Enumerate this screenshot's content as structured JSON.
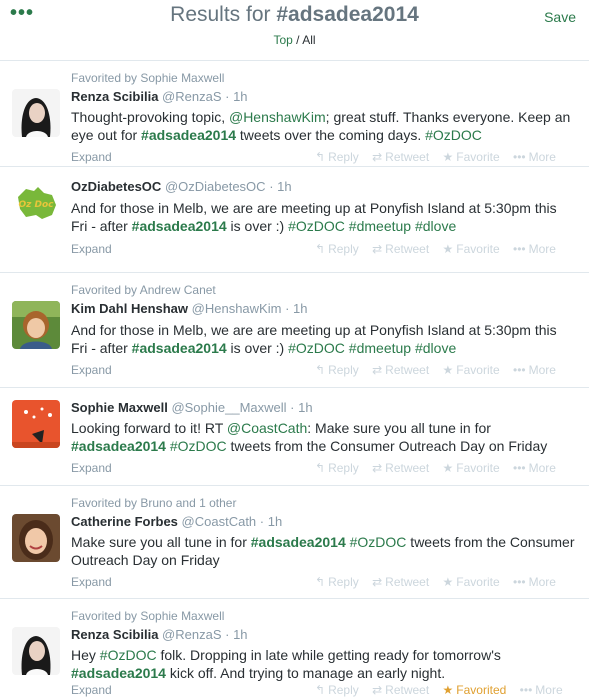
{
  "header": {
    "menu_icon": "more-dots-icon",
    "title_prefix": "Results for",
    "title_query": "#adsadea2014",
    "save_label": "Save",
    "top_label": "Top",
    "separator": "/",
    "all_label": "All"
  },
  "actions": {
    "reply": "Reply",
    "retweet": "Retweet",
    "favorite": "Favorite",
    "favorited": "Favorited",
    "more": "More",
    "expand": "Expand"
  },
  "tweets": [
    {
      "favorited_by": "Favorited by Sophie Maxwell",
      "name": "Renza Scibilia",
      "handle": "@RenzaS",
      "time": "· 1h",
      "parts": [
        {
          "t": "Thought-provoking topic, "
        },
        {
          "t": "@HenshawKim",
          "k": "men"
        },
        {
          "t": "; great stuff. Thanks everyone. Keep an eye out for "
        },
        {
          "t": "#adsadea2014",
          "k": "tagb"
        },
        {
          "t": " tweets over the coming days. "
        },
        {
          "t": "#OzDOC",
          "k": "tag"
        }
      ]
    },
    {
      "favorited_by": "",
      "name": "OzDiabetesOC",
      "handle": "@OzDiabetesOC",
      "time": "· 1h",
      "avatar_text": "Oz Doc",
      "parts": [
        {
          "t": "And for those in Melb, we are are meeting up at Ponyfish Island at 5:30pm this Fri - after "
        },
        {
          "t": "#adsadea2014",
          "k": "tagb"
        },
        {
          "t": " is over :) "
        },
        {
          "t": "#OzDOC",
          "k": "tag"
        },
        {
          "t": " "
        },
        {
          "t": "#dmeetup",
          "k": "tag"
        },
        {
          "t": " "
        },
        {
          "t": "#dlove",
          "k": "tag"
        }
      ]
    },
    {
      "favorited_by": "Favorited by Andrew Canet",
      "name": "Kim Dahl Henshaw",
      "handle": "@HenshawKim",
      "time": "· 1h",
      "parts": [
        {
          "t": "And for those in Melb, we are are meeting up at Ponyfish Island at 5:30pm this Fri - after "
        },
        {
          "t": "#adsadea2014",
          "k": "tagb"
        },
        {
          "t": " is over :) "
        },
        {
          "t": "#OzDOC",
          "k": "tag"
        },
        {
          "t": " "
        },
        {
          "t": "#dmeetup",
          "k": "tag"
        },
        {
          "t": " "
        },
        {
          "t": "#dlove",
          "k": "tag"
        }
      ]
    },
    {
      "favorited_by": "",
      "name": "Sophie Maxwell",
      "handle": "@Sophie__Maxwell",
      "time": "· 1h",
      "parts": [
        {
          "t": "Looking forward to it! RT "
        },
        {
          "t": "@CoastCath",
          "k": "men"
        },
        {
          "t": ": Make sure you all tune in for "
        },
        {
          "t": "#adsadea2014",
          "k": "tagb"
        },
        {
          "t": " "
        },
        {
          "t": "#OzDOC",
          "k": "tag"
        },
        {
          "t": " tweets from the Consumer Outreach Day on Friday"
        }
      ]
    },
    {
      "favorited_by": "Favorited by Bruno and 1 other",
      "name": "Catherine Forbes",
      "handle": "@CoastCath",
      "time": "· 1h",
      "parts": [
        {
          "t": "Make sure you all tune in for "
        },
        {
          "t": "#adsadea2014",
          "k": "tagb"
        },
        {
          "t": " "
        },
        {
          "t": "#OzDOC",
          "k": "tag"
        },
        {
          "t": " tweets from the Consumer Outreach Day on Friday"
        }
      ]
    },
    {
      "favorited_by": "Favorited by Sophie Maxwell",
      "name": "Renza Scibilia",
      "handle": "@RenzaS",
      "time": "· 1h",
      "favorited": true,
      "parts": [
        {
          "t": "Hey "
        },
        {
          "t": "#OzDOC",
          "k": "tag"
        },
        {
          "t": " folk. Dropping in late while getting ready for tomorrow's "
        },
        {
          "t": "#adsadea2014",
          "k": "tagb"
        },
        {
          "t": " kick off. And trying to manage an early night."
        }
      ]
    }
  ]
}
